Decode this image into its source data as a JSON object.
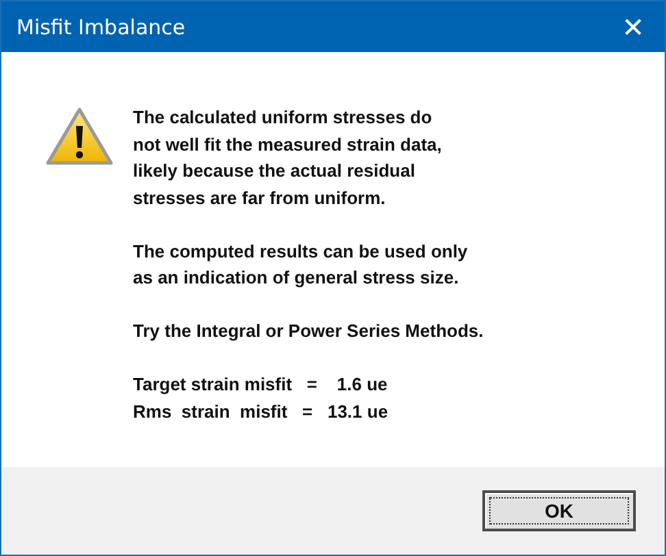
{
  "window": {
    "title": "Misfit Imbalance",
    "close": "✕"
  },
  "message": {
    "paragraphs": [
      [
        "The calculated uniform stresses do",
        "not well fit the measured strain data,",
        "likely because the actual residual",
        "stresses are far from uniform."
      ],
      [
        "The computed results can be used only",
        "as an indication of general stress size."
      ],
      [
        "Try the Integral or Power Series Methods."
      ],
      [
        "Target strain misfit   =    1.6 ue",
        "Rms  strain  misfit   =   13.1 ue"
      ]
    ]
  },
  "buttons": [
    {
      "label": "OK",
      "selected": true
    }
  ]
}
